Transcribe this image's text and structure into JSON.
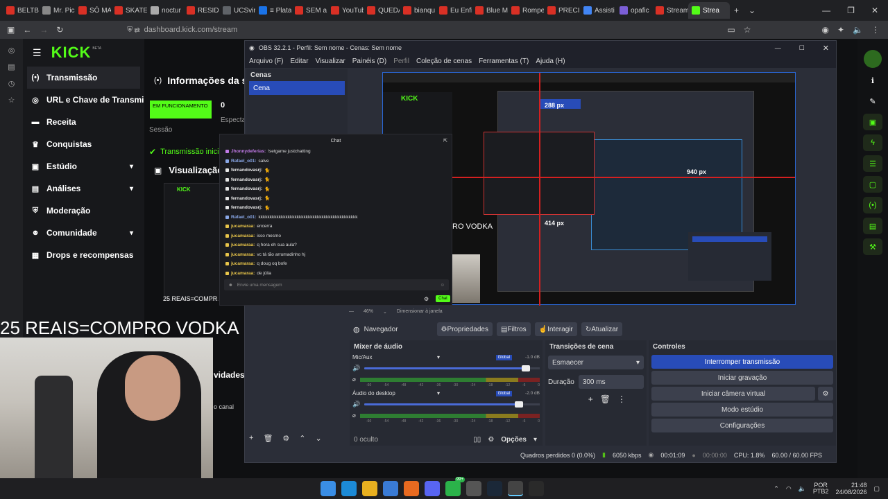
{
  "browser": {
    "tabs": [
      {
        "label": "BELTBO",
        "color": "#d93025"
      },
      {
        "label": "Mr. Pic",
        "color": "#888888"
      },
      {
        "label": "SÓ MA",
        "color": "#d93025"
      },
      {
        "label": "SKATE",
        "color": "#d93025"
      },
      {
        "label": "noctur",
        "color": "#aaaaaa"
      },
      {
        "label": "RESIDE",
        "color": "#d93025"
      },
      {
        "label": "UCSvirt",
        "color": "#5f6368"
      },
      {
        "label": "≡ Plata",
        "color": "#1a73e8"
      },
      {
        "label": "SEM a",
        "color": "#d93025"
      },
      {
        "label": "YouTub",
        "color": "#d93025"
      },
      {
        "label": "QUEDA",
        "color": "#d93025"
      },
      {
        "label": "bianqu",
        "color": "#d93025"
      },
      {
        "label": "Eu Enfi",
        "color": "#d93025"
      },
      {
        "label": "Blue M",
        "color": "#d93025"
      },
      {
        "label": "Rompe",
        "color": "#d93025"
      },
      {
        "label": "PRECIS",
        "color": "#d93025"
      },
      {
        "label": "Assisti",
        "color": "#4285f4"
      },
      {
        "label": "opafic",
        "color": "#7b5ed6"
      },
      {
        "label": "Stream",
        "color": "#d93025"
      },
      {
        "label": "Strea",
        "color": "#53fc18",
        "active": true
      }
    ],
    "url": "dashboard.kick.com/stream"
  },
  "kick": {
    "logo": "KICK",
    "logo_sup": "BETA",
    "nav": [
      {
        "label": "Transmissão",
        "icon": "(•)",
        "active": true
      },
      {
        "label": "URL e Chave de Transmissão",
        "icon": "◎"
      },
      {
        "label": "Receita",
        "icon": "▬"
      },
      {
        "label": "Conquistas",
        "icon": "♛"
      },
      {
        "label": "Estúdio",
        "icon": "▣",
        "chevron": true
      },
      {
        "label": "Análises",
        "icon": "▤",
        "chevron": true
      },
      {
        "label": "Moderação",
        "icon": "⛨"
      },
      {
        "label": "Comunidade",
        "icon": "☻",
        "chevron": true
      },
      {
        "label": "Drops e recompensas",
        "icon": "▦"
      }
    ],
    "info_title": "Informações da se",
    "live_badge": "EM FUNCIONAMENTO",
    "session_label": "Sessão",
    "session_value": "0",
    "spectators_label": "Especta",
    "stream_started": "Transmissão iniciad",
    "preview_title": "Visualização",
    "activities": "vidades",
    "canal": "o canal"
  },
  "obs": {
    "title": "OBS 32.2.1 - Perfil: Sem nome - Cenas: Sem nome",
    "menu": [
      "Arquivo (F)",
      "Editar",
      "Visualizar",
      "Painéis (D)",
      "Perfil",
      "Coleção de cenas",
      "Ferramentas (T)",
      "Ajuda (H)"
    ],
    "scenes_title": "Cenas",
    "scene_item": "Cena",
    "zoom": "46%",
    "resize": "Dimensionar à janela",
    "source_bar": {
      "navigator": "Navegador",
      "properties": "Propriedades",
      "filters": "Filtros",
      "interact": "Interagir",
      "refresh": "Atualizar"
    },
    "mixer": {
      "title": "Mixer de áudio",
      "channels": [
        {
          "name": "Mic/Aux",
          "tag": "Global",
          "db": "-1.0 dB",
          "level": 0.92
        },
        {
          "name": "Áudio do desktop",
          "tag": "Global",
          "db": "-2.0 dB",
          "level": 0.88
        }
      ],
      "ticks": [
        "-60",
        "-54",
        "-48",
        "-42",
        "-36",
        "-30",
        "-24",
        "-18",
        "-12",
        "-6",
        "0"
      ],
      "hidden": "0 oculto",
      "options": "Opções"
    },
    "transitions": {
      "title": "Transições de cena",
      "selected": "Esmaecer",
      "duration_label": "Duração",
      "duration_value": "300 ms"
    },
    "controls": {
      "title": "Controles",
      "stop_stream": "Interromper transmissão",
      "start_recording": "Iniciar gravação",
      "virtual_cam": "Iniciar câmera virtual",
      "studio_mode": "Modo estúdio",
      "settings": "Configurações"
    },
    "status": {
      "dropped": "Quadros perdidos 0 (0.0%)",
      "bitrate": "6050 kbps",
      "live_time": "00:01:09",
      "rec_time": "00:00:00",
      "cpu": "CPU: 1.8%",
      "fps": "60.00 / 60.00 FPS"
    }
  },
  "chat": {
    "title": "Chat",
    "messages": [
      {
        "user": "Jhonnydeferias:",
        "text": "!setgame justchatting",
        "color": "#c27ae8"
      },
      {
        "user": "Rafael_o01:",
        "text": "salve",
        "color": "#8aa8e8"
      },
      {
        "user": "fernandovasrj:",
        "text": "🐈",
        "color": "#e8e8e8"
      },
      {
        "user": "fernandovasrj:",
        "text": "🐈",
        "color": "#e8e8e8"
      },
      {
        "user": "fernandovasrj:",
        "text": "🐈",
        "color": "#e8e8e8"
      },
      {
        "user": "fernandovasrj:",
        "text": "🐈",
        "color": "#e8e8e8"
      },
      {
        "user": "fernandovasrj:",
        "text": "🐈",
        "color": "#e8e8e8"
      },
      {
        "user": "Rafael_o01:",
        "text": "kkkkkkkkkkkkkkkkkkkkkkkkkkkkkkkkkkkkkkkkkkkk",
        "color": "#8aa8e8"
      },
      {
        "user": "jucamaraa:",
        "text": "encerra",
        "color": "#e8c54a"
      },
      {
        "user": "jucamaraa:",
        "text": "isso mesmo",
        "color": "#e8c54a"
      },
      {
        "user": "jucamaraa:",
        "text": "q hora eh sua aula?",
        "color": "#e8c54a"
      },
      {
        "user": "jucamaraa:",
        "text": "vc tá tão arrumadinho hj",
        "color": "#e8c54a"
      },
      {
        "user": "jucamaraa:",
        "text": "q doug oq bofe",
        "color": "#e8c54a"
      },
      {
        "user": "jucamaraa:",
        "text": "de júlia",
        "color": "#e8c54a"
      }
    ],
    "placeholder": "Envie uma mensagem",
    "send": "Chat"
  },
  "overlay": {
    "text": "25 REAIS=COMPRO VODKA",
    "small_text": "25 REAIS=COMPR",
    "preview_text": "RO VODKA",
    "px_labels": [
      "288 px",
      "940 px",
      "414 px"
    ]
  },
  "taskbar": {
    "lang": "POR",
    "lang2": "PTB2",
    "time": "21:48",
    "date": "24/08/2026",
    "badge": "99+"
  }
}
